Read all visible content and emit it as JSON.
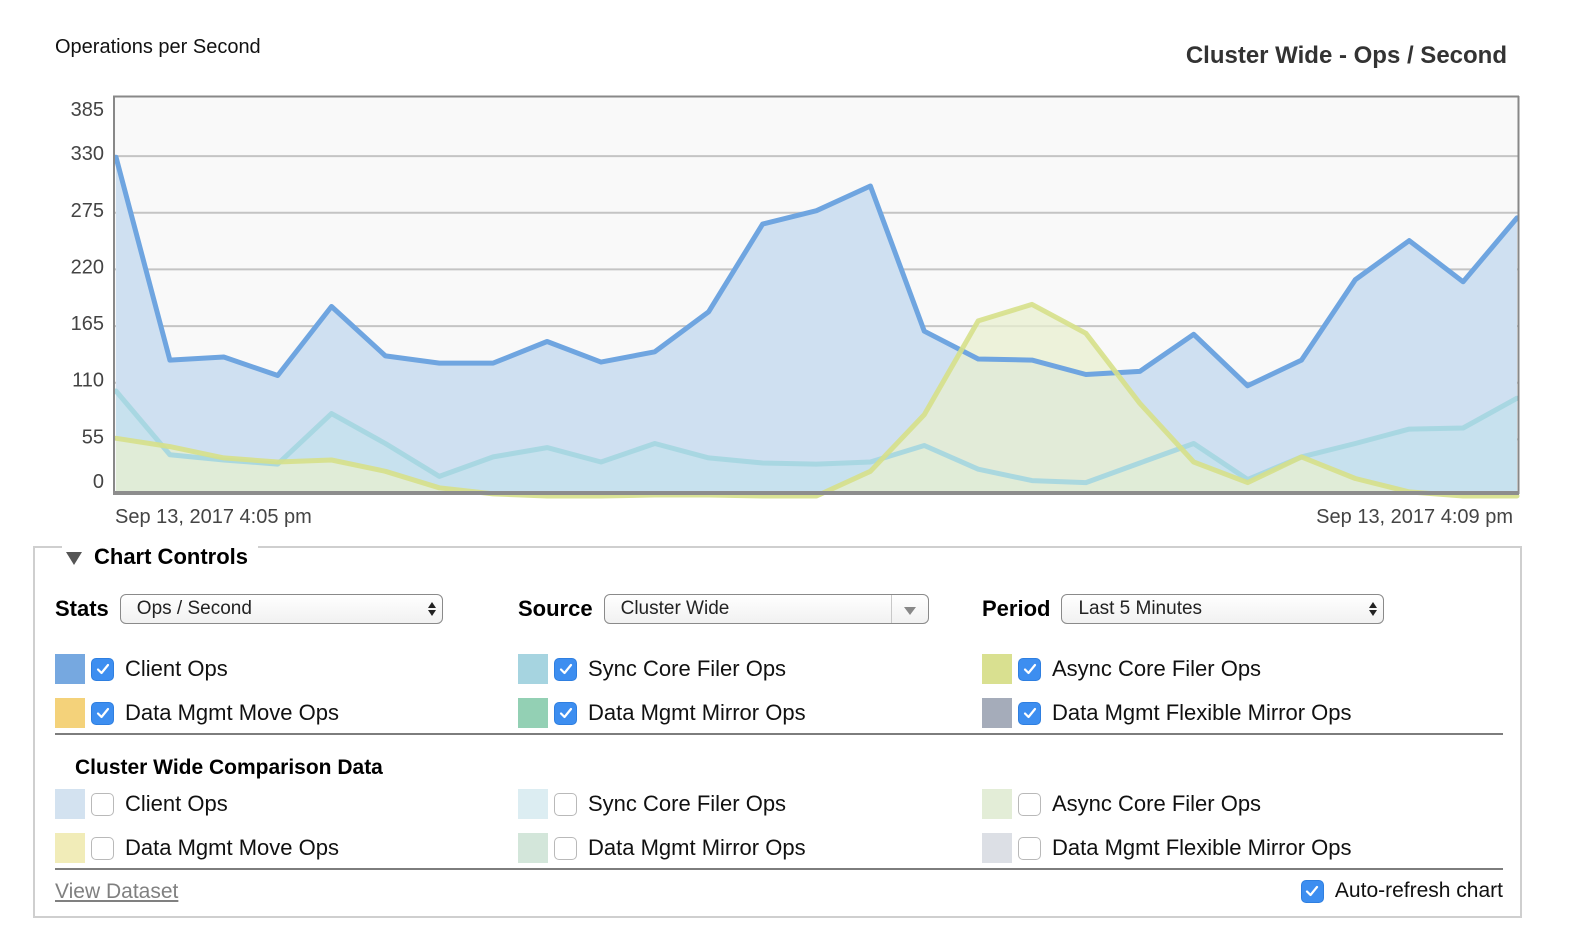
{
  "header": {
    "subtitle": "Operations per Second",
    "title": "Cluster Wide - Ops / Second"
  },
  "chart_data": {
    "type": "area",
    "title": "Cluster Wide - Ops / Second",
    "ylabel": "Operations per Second",
    "xlabel": "",
    "ylim": [
      0,
      385
    ],
    "yticks": [
      0,
      55,
      110,
      165,
      220,
      275,
      330,
      385
    ],
    "x_tick_labels": [
      "Sep 13, 2017 4:05 pm",
      "Sep 13, 2017 4:09 pm"
    ],
    "grid": true,
    "n_points": 27,
    "series": [
      {
        "name": "Client Ops",
        "color": "#6fa5e0",
        "fill": "#cfe0f1",
        "values": [
          329,
          132,
          135,
          117,
          184,
          136,
          129,
          129,
          150,
          130,
          140,
          179,
          264,
          277,
          301,
          160,
          133,
          132,
          118,
          121,
          157,
          107,
          132,
          210,
          248,
          208,
          270
        ]
      },
      {
        "name": "Sync Core Filer Ops",
        "color": "#a4d6e0",
        "fill": "#c4e1ec",
        "values": [
          102,
          40,
          35,
          31,
          80,
          51,
          19,
          38,
          47,
          33,
          51,
          37,
          32,
          31,
          33,
          49,
          26,
          15,
          13,
          32,
          51,
          16,
          38,
          51,
          65,
          66,
          95
        ]
      },
      {
        "name": "Async Core Filer Ops",
        "color": "#d6e08a",
        "fill": "#e8efcf",
        "values": [
          56,
          48,
          37,
          33,
          35,
          24,
          8,
          2,
          0,
          0,
          1,
          1,
          0,
          0,
          24,
          79,
          170,
          186,
          158,
          90,
          33,
          13,
          38,
          17,
          4,
          0,
          0
        ]
      }
    ]
  },
  "controls": {
    "legend_title": "Chart Controls",
    "stats": {
      "label": "Stats",
      "value": "Ops / Second"
    },
    "source": {
      "label": "Source",
      "value": "Cluster Wide"
    },
    "period": {
      "label": "Period",
      "value": "Last 5 Minutes"
    },
    "series_toggles": [
      {
        "label": "Client Ops",
        "color": "#76a8e0",
        "checked": true
      },
      {
        "label": "Sync Core Filer Ops",
        "color": "#a6d4e0",
        "checked": true
      },
      {
        "label": "Async Core Filer Ops",
        "color": "#d9e090",
        "checked": true
      },
      {
        "label": "Data Mgmt Move Ops",
        "color": "#f4d27a",
        "checked": true
      },
      {
        "label": "Data Mgmt Mirror Ops",
        "color": "#93d0b4",
        "checked": true
      },
      {
        "label": "Data Mgmt Flexible Mirror Ops",
        "color": "#a5acba",
        "checked": true
      }
    ],
    "comparison_title": "Cluster Wide Comparison Data",
    "comparison_toggles": [
      {
        "label": "Client Ops",
        "color": "#d3e2f0",
        "checked": false
      },
      {
        "label": "Sync Core Filer Ops",
        "color": "#dcedf2",
        "checked": false
      },
      {
        "label": "Async Core Filer Ops",
        "color": "#e3edd7",
        "checked": false
      },
      {
        "label": "Data Mgmt Move Ops",
        "color": "#f1ecb8",
        "checked": false
      },
      {
        "label": "Data Mgmt Mirror Ops",
        "color": "#d3e6da",
        "checked": false
      },
      {
        "label": "Data Mgmt Flexible Mirror Ops",
        "color": "#dcdfe5",
        "checked": false
      }
    ],
    "view_dataset": "View Dataset",
    "auto_refresh": {
      "label": "Auto-refresh chart",
      "checked": true
    }
  }
}
